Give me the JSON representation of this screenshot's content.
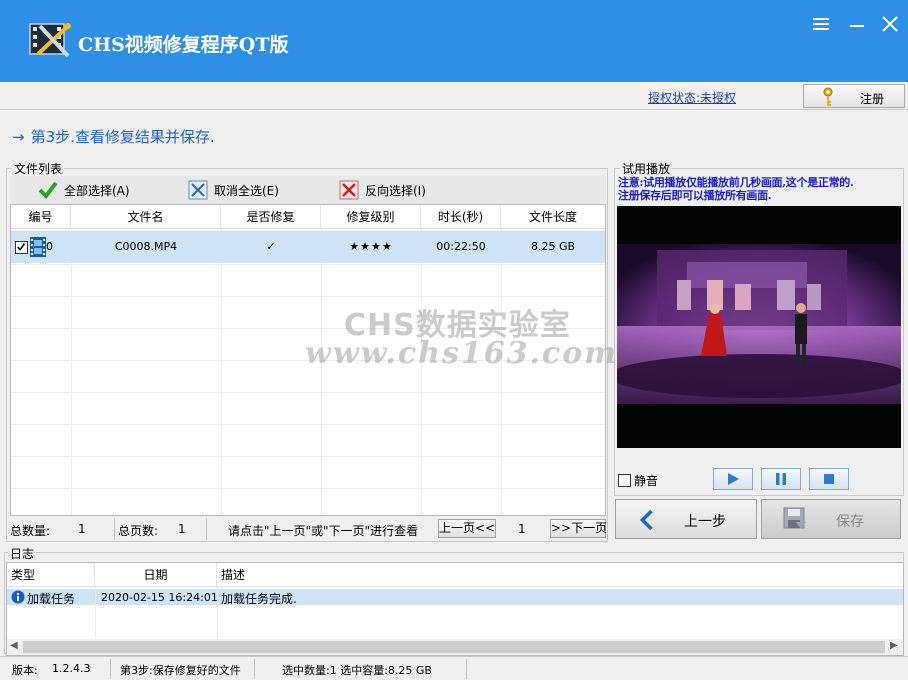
{
  "app": {
    "title": "CHS视频修复程序QT版",
    "logo_icon": "video-repair-tools-icon"
  },
  "license": {
    "status_link": "授权状态:未授权",
    "register_label": "注册"
  },
  "step_header": "第3步.查看修复结果并保存.",
  "file_list": {
    "group_title": "文件列表",
    "toolbar": {
      "select_all": "全部选择(A)",
      "deselect_all": "取消全选(E)",
      "invert_select": "反向选择(I)"
    },
    "columns": [
      "编号",
      "文件名",
      "是否修复",
      "修复级别",
      "时长(秒)",
      "文件长度"
    ],
    "rows": [
      {
        "checked": true,
        "index": "0",
        "filename": "C0008.MP4",
        "repaired": "✓",
        "level": "★★★★",
        "duration": "00:22:50",
        "size": "8.25 GB"
      }
    ],
    "pager": {
      "total_count_label": "总数量:",
      "total_count": "1",
      "total_pages_label": "总页数:",
      "total_pages": "1",
      "hint": "请点击\"上一页\"或\"下一页\"进行查看",
      "prev_page": "上一页<<",
      "current_page": "1",
      "next_page": ">>下一页"
    }
  },
  "preview": {
    "group_title": "试用播放",
    "notice_line1": "注意:试用播放仅能播放前几秒画面,这个是正常的.",
    "notice_line2": "注册保存后即可以播放所有画面.",
    "mute_label": "静音",
    "mute_checked": false
  },
  "actions": {
    "prev_step": "上一步",
    "save": "保存"
  },
  "log": {
    "group_title": "日志",
    "columns": [
      "类型",
      "日期",
      "描述"
    ],
    "rows": [
      {
        "type": "加载任务",
        "date": "2020-02-15 16:24:01",
        "desc": "加载任务完成."
      }
    ]
  },
  "statusbar": {
    "version_label": "版本:",
    "version": "1.2.4.3",
    "step_text": "第3步:保存修复好的文件",
    "selection_text": "选中数量:1 选中容量:8.25 GB"
  },
  "watermark": {
    "line1": "CHS数据实验室",
    "line2": "www.chs163.com"
  },
  "colors": {
    "titlebar": "#2e8fe6",
    "accent_text": "#1a66c4",
    "notice": "#1a1ad0",
    "selected_row": "#cfe3f7"
  }
}
